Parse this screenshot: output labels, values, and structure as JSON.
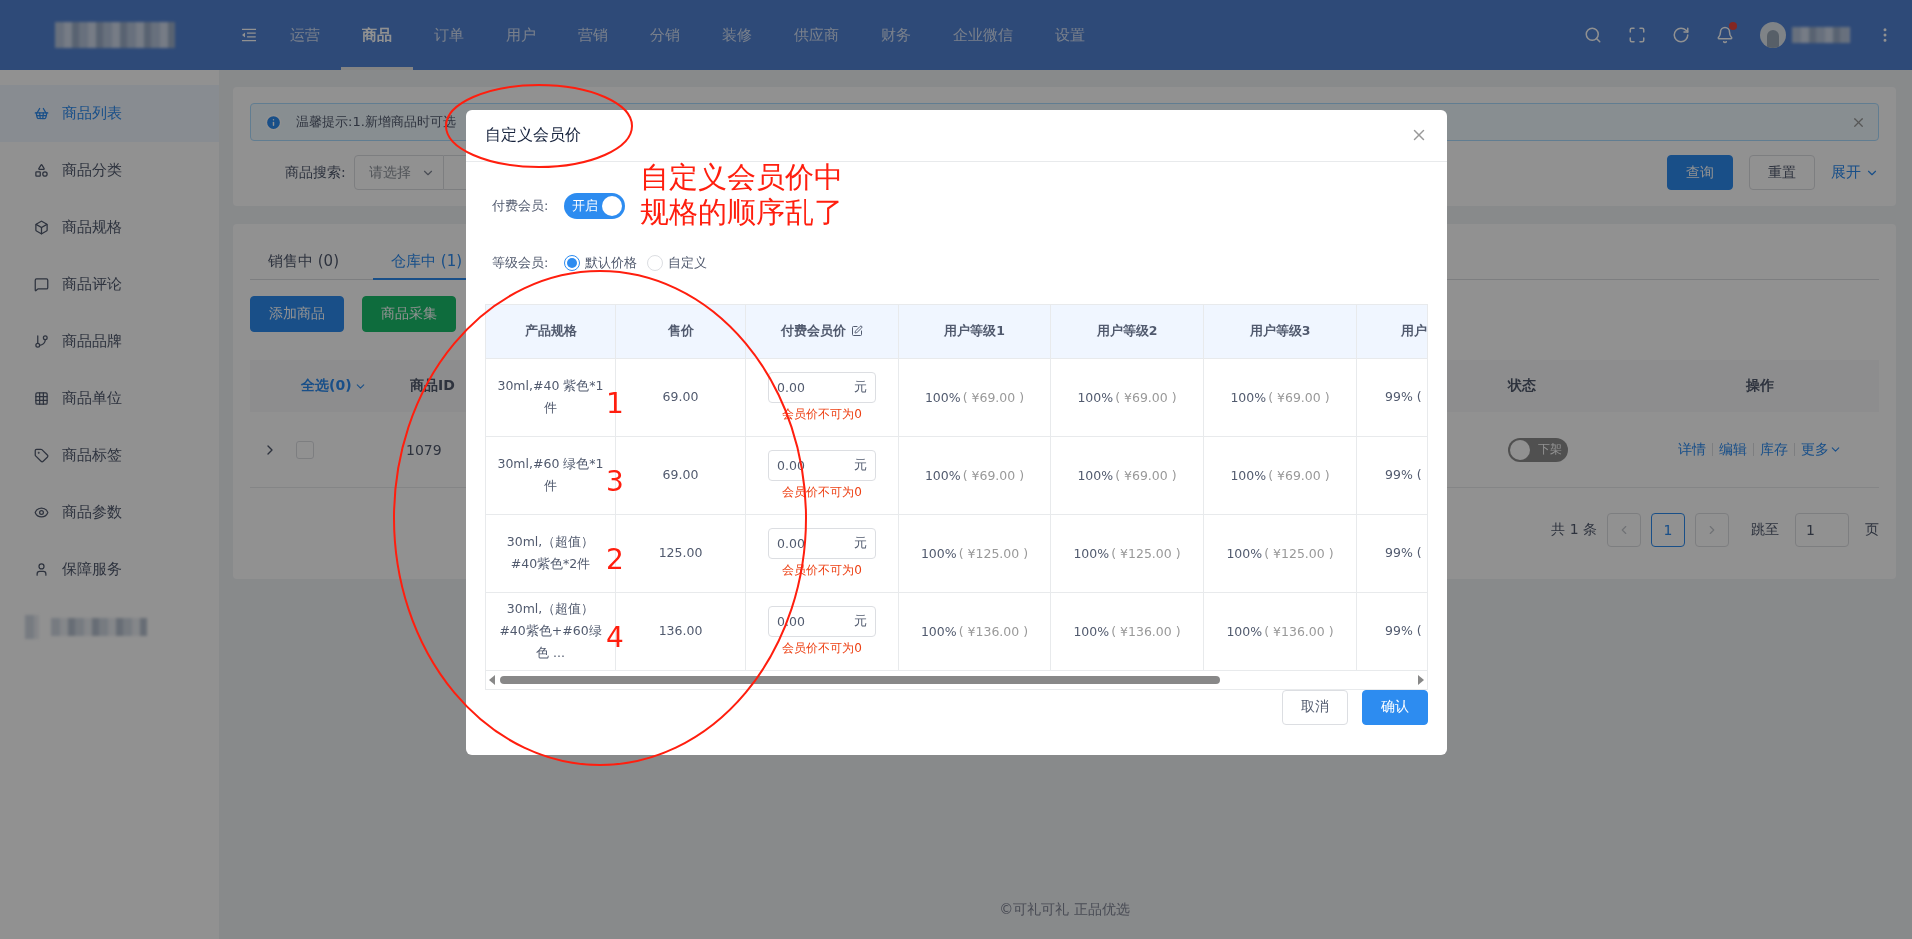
{
  "top_nav": {
    "items": [
      {
        "label": "运营",
        "selected": false
      },
      {
        "label": "商品",
        "selected": true
      },
      {
        "label": "订单",
        "selected": false
      },
      {
        "label": "用户",
        "selected": false
      },
      {
        "label": "营销",
        "selected": false
      },
      {
        "label": "分销",
        "selected": false
      },
      {
        "label": "装修",
        "selected": false
      },
      {
        "label": "供应商",
        "selected": false
      },
      {
        "label": "财务",
        "selected": false
      },
      {
        "label": "企业微信",
        "selected": false
      },
      {
        "label": "设置",
        "selected": false
      }
    ],
    "has_unread": true
  },
  "sidebar": {
    "items": [
      {
        "label": "商品列表",
        "selected": true
      },
      {
        "label": "商品分类",
        "selected": false
      },
      {
        "label": "商品规格",
        "selected": false
      },
      {
        "label": "商品评论",
        "selected": false
      },
      {
        "label": "商品品牌",
        "selected": false
      },
      {
        "label": "商品单位",
        "selected": false
      },
      {
        "label": "商品标签",
        "selected": false
      },
      {
        "label": "商品参数",
        "selected": false
      },
      {
        "label": "保障服务",
        "selected": false
      }
    ]
  },
  "notice": {
    "text": "温馨提示:1.新增商品时可选"
  },
  "search": {
    "label": "商品搜索:",
    "select_placeholder": "请选择",
    "buttons": [
      {
        "label": "查询",
        "kind": "primary"
      },
      {
        "label": "重置",
        "kind": "default"
      }
    ],
    "expand": "展开"
  },
  "tabs": [
    {
      "label": "销售中 (0)",
      "selected": false
    },
    {
      "label": "仓库中 (1)",
      "selected": true
    }
  ],
  "actions": [
    {
      "label": "添加商品",
      "kind": "primary"
    },
    {
      "label": "商品采集",
      "kind": "success"
    }
  ],
  "product_table": {
    "columns": {
      "select_all": "全选(0)",
      "id": "商品ID",
      "status": "状态",
      "operations": "操作"
    },
    "rows": [
      {
        "expanded": false,
        "checked": false,
        "id": "1079",
        "status": {
          "label": "下架",
          "on": false
        },
        "links": [
          "详情",
          "编辑",
          "库存",
          "更多"
        ]
      }
    ]
  },
  "pagination": {
    "total": "共 1 条",
    "pages": [
      {
        "label": "1",
        "selected": true
      }
    ],
    "jump_label": "跳至",
    "jump_value": "1",
    "page_suffix": "页"
  },
  "footer": "©可礼可礼 正品优选",
  "dialog": {
    "title": "自定义会员价",
    "paid_member": {
      "label": "付费会员:",
      "on": true,
      "switch_text": "开启"
    },
    "level_member": {
      "label": "等级会员:",
      "options": [
        {
          "label": "默认价格",
          "selected": true
        },
        {
          "label": "自定义",
          "selected": false
        }
      ]
    },
    "table": {
      "columns": [
        "产品规格",
        "售价",
        "付费会员价",
        "用户等级1",
        "用户等级2",
        "用户等级3",
        "用户"
      ],
      "rows": [
        {
          "spec": "30ml,#40 紫色*1件",
          "price": "69.00",
          "member_price": "0.00",
          "unit": "元",
          "error": "会员价不可为0",
          "levels": [
            {
              "percent": "100%",
              "amount": "( ¥69.00 )"
            },
            {
              "percent": "100%",
              "amount": "( ¥69.00 )"
            },
            {
              "percent": "100%",
              "amount": "( ¥69.00 )"
            }
          ],
          "level_cut": "99% ("
        },
        {
          "spec": "30ml,#60 绿色*1件",
          "price": "69.00",
          "member_price": "0.00",
          "unit": "元",
          "error": "会员价不可为0",
          "levels": [
            {
              "percent": "100%",
              "amount": "( ¥69.00 )"
            },
            {
              "percent": "100%",
              "amount": "( ¥69.00 )"
            },
            {
              "percent": "100%",
              "amount": "( ¥69.00 )"
            }
          ],
          "level_cut": "99% ("
        },
        {
          "spec": "30ml,（超值）#40紫色*2件",
          "price": "125.00",
          "member_price": "0.00",
          "unit": "元",
          "error": "会员价不可为0",
          "levels": [
            {
              "percent": "100%",
              "amount": "( ¥125.00 )"
            },
            {
              "percent": "100%",
              "amount": "( ¥125.00 )"
            },
            {
              "percent": "100%",
              "amount": "( ¥125.00 )"
            }
          ],
          "level_cut": "99% ("
        },
        {
          "spec": "30ml,（超值）#40紫色+#60绿色 ...",
          "price": "136.00",
          "member_price": "0.00",
          "unit": "元",
          "error": "会员价不可为0",
          "levels": [
            {
              "percent": "100%",
              "amount": "( ¥136.00 )"
            },
            {
              "percent": "100%",
              "amount": "( ¥136.00 )"
            },
            {
              "percent": "100%",
              "amount": "( ¥136.00 )"
            }
          ],
          "level_cut": "99% ("
        }
      ]
    },
    "buttons": [
      {
        "label": "取消",
        "kind": "default"
      },
      {
        "label": "确认",
        "kind": "primary"
      }
    ]
  },
  "annotations": {
    "note_lines": [
      "自定义会员价中",
      "规格的顺序乱了"
    ],
    "row_numbers": [
      "1",
      "3",
      "2",
      "4"
    ]
  }
}
